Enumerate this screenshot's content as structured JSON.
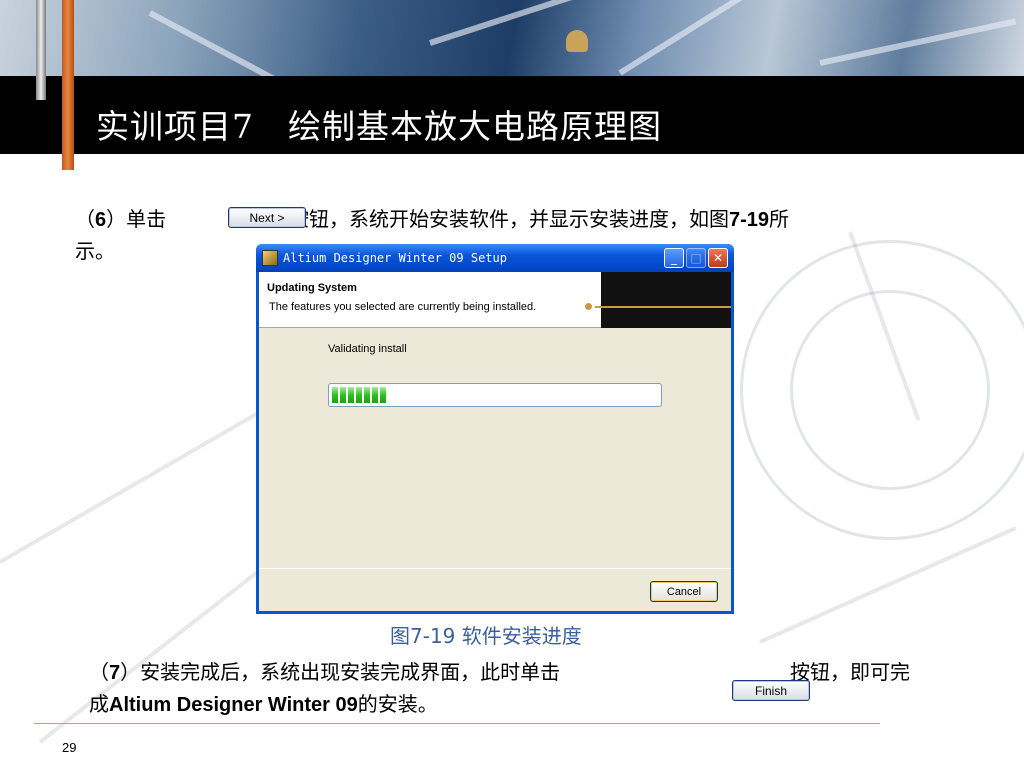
{
  "slide": {
    "title": "实训项目7　绘制基本放大电路原理图",
    "page_number": "29"
  },
  "para6": {
    "prefix": "（",
    "num": "6",
    "mid": "）单击",
    "after_button": "按钮，系统开始安装软件，并显示安装进度，如图",
    "fig_ref": "7-19",
    "suffix": "所",
    "line2": "示。",
    "button_label": "Next >"
  },
  "window": {
    "title": "Altium Designer Winter 09 Setup",
    "header_title": "Updating System",
    "header_subtitle": "The features you selected are currently being installed.",
    "status": "Validating install",
    "progress_percent": 18,
    "cancel_label": "Cancel",
    "minimize_glyph": "_",
    "maximize_glyph": "□",
    "close_glyph": "✕"
  },
  "caption": "图7-19 软件安装进度",
  "para7": {
    "prefix": "（",
    "num": "7",
    "mid": "）安装完成后，系统出现安装完成界面，此时单击",
    "after_button": "按钮，即可完",
    "line2_prefix": "成",
    "product": "Altium Designer Winter 09",
    "line2_suffix": "的安装。",
    "button_label": "Finish"
  },
  "colors": {
    "title_bar": "#000000",
    "title_text": "#ffffff",
    "caption": "#3b5fa0",
    "accent_orange": "#e8873d",
    "progress_green": "#2bc51e"
  }
}
